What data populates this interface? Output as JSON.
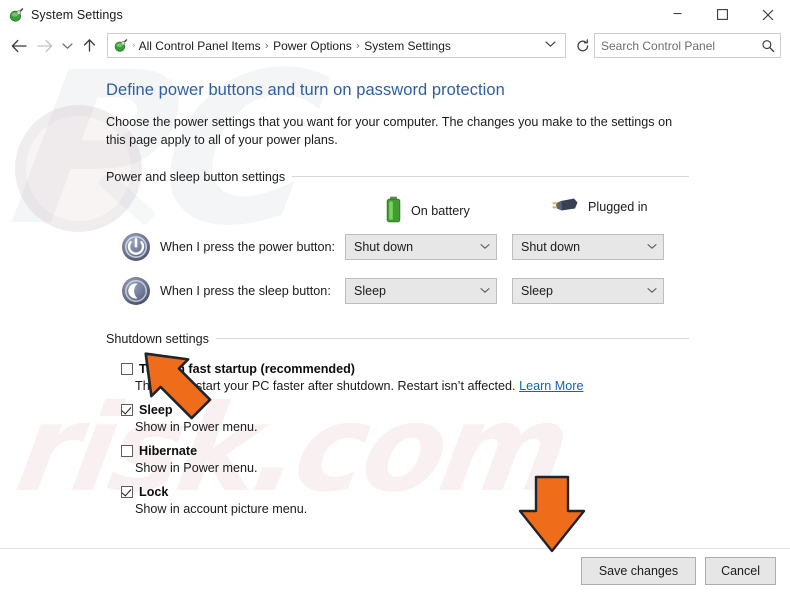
{
  "window": {
    "title": "System Settings",
    "icon": "control-panel-icon",
    "controls": {
      "minimize": "─",
      "maximize": "☐",
      "close": "✕"
    }
  },
  "navbar": {
    "back": "←",
    "forward": "→",
    "recent": "∨",
    "up": "↑",
    "breadcrumb_icon": "control-panel-icon",
    "breadcrumbs": [
      "All Control Panel Items",
      "Power Options",
      "System Settings"
    ],
    "separator": "›",
    "dropdown_chevron": "∨",
    "refresh": "↻",
    "search": {
      "placeholder": "Search Control Panel",
      "value": "",
      "icon": "search-icon"
    }
  },
  "page": {
    "heading": "Define power buttons and turn on password protection",
    "description": "Choose the power settings that you want for your computer. The changes you make to the settings on this page apply to all of your power plans."
  },
  "power_sleep_group": {
    "label": "Power and sleep button settings",
    "columns": [
      {
        "label": "On battery",
        "icon": "battery-icon"
      },
      {
        "label": "Plugged in",
        "icon": "power-plug-icon"
      }
    ],
    "rows": [
      {
        "icon": "power-button-icon",
        "label": "When I press the power button:",
        "on_battery": "Shut down",
        "plugged_in": "Shut down",
        "chevron": "∨"
      },
      {
        "icon": "sleep-button-icon",
        "label": "When I press the sleep button:",
        "on_battery": "Sleep",
        "plugged_in": "Sleep",
        "chevron": "∨"
      }
    ]
  },
  "shutdown_group": {
    "label": "Shutdown settings",
    "items": [
      {
        "title": "Turn on fast startup (recommended)",
        "checked": false,
        "description": "This helps start your PC faster after shutdown. Restart isn’t affected. ",
        "link": "Learn More"
      },
      {
        "title": "Sleep",
        "checked": true,
        "description": "Show in Power menu.",
        "link": ""
      },
      {
        "title": "Hibernate",
        "checked": false,
        "description": "Show in Power menu.",
        "link": ""
      },
      {
        "title": "Lock",
        "checked": true,
        "description": "Show in account picture menu.",
        "link": ""
      }
    ]
  },
  "footer": {
    "save_label": "Save changes",
    "cancel_label": "Cancel"
  },
  "annotations": {
    "arrow_color": "#ef6c1a",
    "arrow_1": "points-at-fast-startup-checkbox",
    "arrow_2": "points-at-save-changes-button"
  },
  "theme": {
    "heading_color": "#2d5fa8",
    "link_color": "#1763b5",
    "text_color": "#1b1b1b",
    "combo_bg": "#e7e7e7",
    "button_bg": "#e6e6e6"
  },
  "watermark": {
    "top_text": "PC",
    "bottom_text": "risk.com"
  }
}
